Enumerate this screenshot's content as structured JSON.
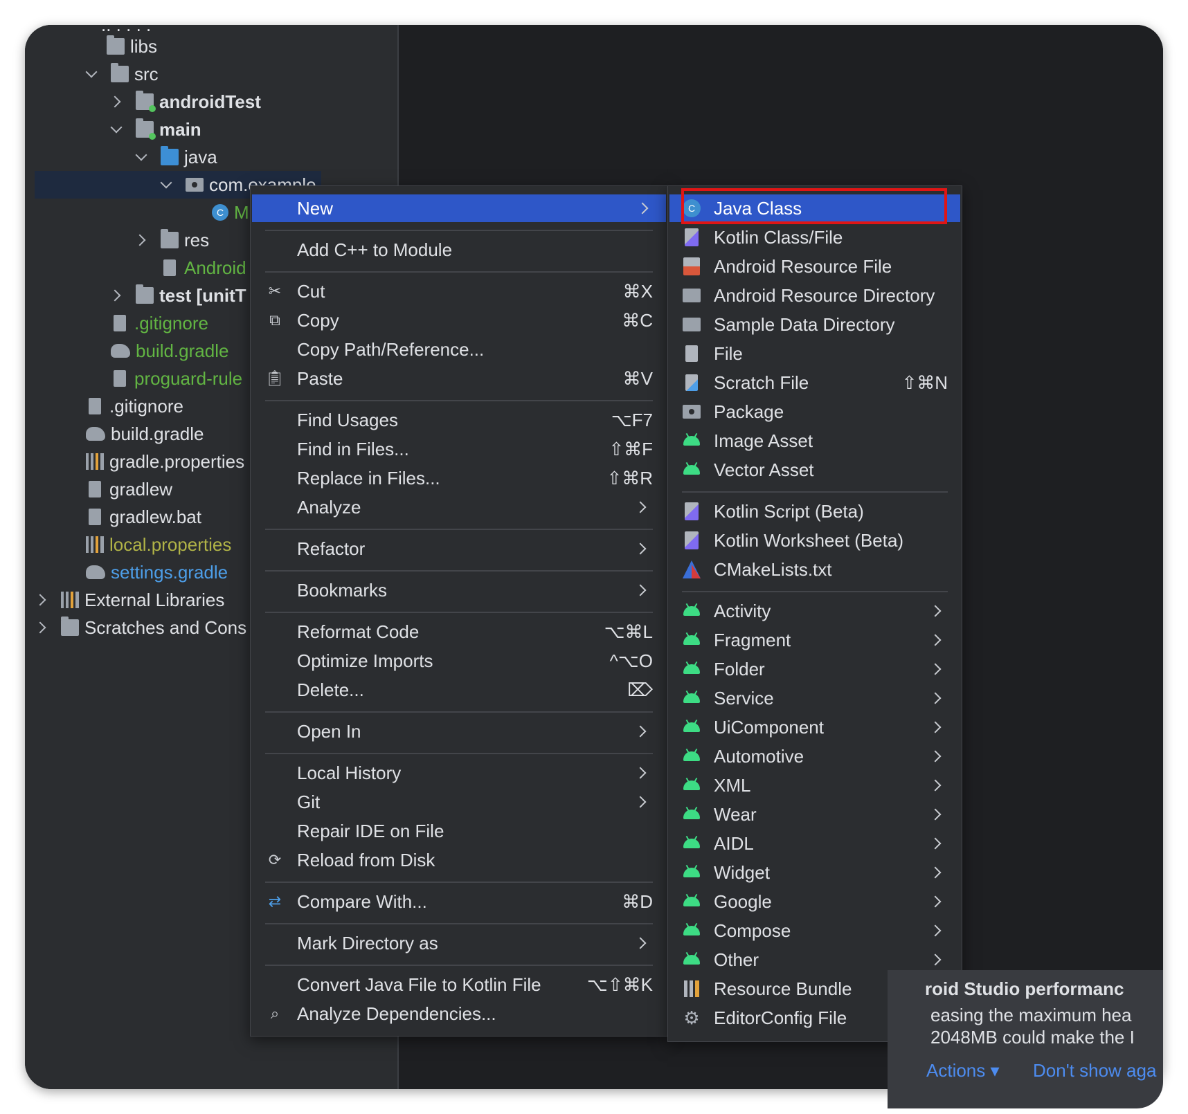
{
  "tree": {
    "items": [
      {
        "label": "libs"
      },
      {
        "label": "src"
      },
      {
        "label": "androidTest"
      },
      {
        "label": "main"
      },
      {
        "label": "java"
      },
      {
        "label": "com.example"
      },
      {
        "label": "M"
      },
      {
        "label": "res"
      },
      {
        "label": "Android"
      },
      {
        "label": "test [unitT"
      },
      {
        "label": ".gitignore"
      },
      {
        "label": "build.gradle"
      },
      {
        "label": "proguard-rule"
      },
      {
        "label": ".gitignore"
      },
      {
        "label": "build.gradle"
      },
      {
        "label": "gradle.properties"
      },
      {
        "label": "gradlew"
      },
      {
        "label": "gradlew.bat"
      },
      {
        "label": "local.properties"
      },
      {
        "label": "settings.gradle"
      },
      {
        "label": "External Libraries"
      },
      {
        "label": "Scratches and Cons"
      }
    ]
  },
  "context_menu": {
    "items": [
      {
        "label": "New",
        "shortcut": ""
      },
      {
        "label": "Add C++ to Module",
        "shortcut": ""
      },
      {
        "label": "Cut",
        "shortcut": "⌘X"
      },
      {
        "label": "Copy",
        "shortcut": "⌘C"
      },
      {
        "label": "Copy Path/Reference...",
        "shortcut": ""
      },
      {
        "label": "Paste",
        "shortcut": "⌘V"
      },
      {
        "label": "Find Usages",
        "shortcut": "⌥F7"
      },
      {
        "label": "Find in Files...",
        "shortcut": "⇧⌘F"
      },
      {
        "label": "Replace in Files...",
        "shortcut": "⇧⌘R"
      },
      {
        "label": "Analyze",
        "shortcut": ""
      },
      {
        "label": "Refactor",
        "shortcut": ""
      },
      {
        "label": "Bookmarks",
        "shortcut": ""
      },
      {
        "label": "Reformat Code",
        "shortcut": "⌥⌘L"
      },
      {
        "label": "Optimize Imports",
        "shortcut": "^⌥O"
      },
      {
        "label": "Delete...",
        "shortcut": "⌦"
      },
      {
        "label": "Open In",
        "shortcut": ""
      },
      {
        "label": "Local History",
        "shortcut": ""
      },
      {
        "label": "Git",
        "shortcut": ""
      },
      {
        "label": "Repair IDE on File",
        "shortcut": ""
      },
      {
        "label": "Reload from Disk",
        "shortcut": ""
      },
      {
        "label": "Compare With...",
        "shortcut": "⌘D"
      },
      {
        "label": "Mark Directory as",
        "shortcut": ""
      },
      {
        "label": "Convert Java File to Kotlin File",
        "shortcut": "⌥⇧⌘K"
      },
      {
        "label": "Analyze Dependencies...",
        "shortcut": ""
      }
    ]
  },
  "new_submenu": {
    "items": [
      {
        "label": "Java Class",
        "shortcut": ""
      },
      {
        "label": "Kotlin Class/File",
        "shortcut": ""
      },
      {
        "label": "Android Resource File",
        "shortcut": ""
      },
      {
        "label": "Android Resource Directory",
        "shortcut": ""
      },
      {
        "label": "Sample Data Directory",
        "shortcut": ""
      },
      {
        "label": "File",
        "shortcut": ""
      },
      {
        "label": "Scratch File",
        "shortcut": "⇧⌘N"
      },
      {
        "label": "Package",
        "shortcut": ""
      },
      {
        "label": "Image Asset",
        "shortcut": ""
      },
      {
        "label": "Vector Asset",
        "shortcut": ""
      },
      {
        "label": "Kotlin Script (Beta)",
        "shortcut": ""
      },
      {
        "label": "Kotlin Worksheet (Beta)",
        "shortcut": ""
      },
      {
        "label": "CMakeLists.txt",
        "shortcut": ""
      },
      {
        "label": "Activity",
        "shortcut": ""
      },
      {
        "label": "Fragment",
        "shortcut": ""
      },
      {
        "label": "Folder",
        "shortcut": ""
      },
      {
        "label": "Service",
        "shortcut": ""
      },
      {
        "label": "UiComponent",
        "shortcut": ""
      },
      {
        "label": "Automotive",
        "shortcut": ""
      },
      {
        "label": "XML",
        "shortcut": ""
      },
      {
        "label": "Wear",
        "shortcut": ""
      },
      {
        "label": "AIDL",
        "shortcut": ""
      },
      {
        "label": "Widget",
        "shortcut": ""
      },
      {
        "label": "Google",
        "shortcut": ""
      },
      {
        "label": "Compose",
        "shortcut": ""
      },
      {
        "label": "Other",
        "shortcut": ""
      },
      {
        "label": "Resource Bundle",
        "shortcut": ""
      },
      {
        "label": "EditorConfig File",
        "shortcut": ""
      }
    ]
  },
  "notification": {
    "title": "roid Studio performanc",
    "line1": "easing the maximum hea",
    "line2": "2048MB could make the I",
    "actions_label": "Actions ▾",
    "dont_show_label": "Don't show aga"
  },
  "colors": {
    "accent": "#2e57c8",
    "highlight": "#e01515",
    "android": "#3ddc84"
  }
}
